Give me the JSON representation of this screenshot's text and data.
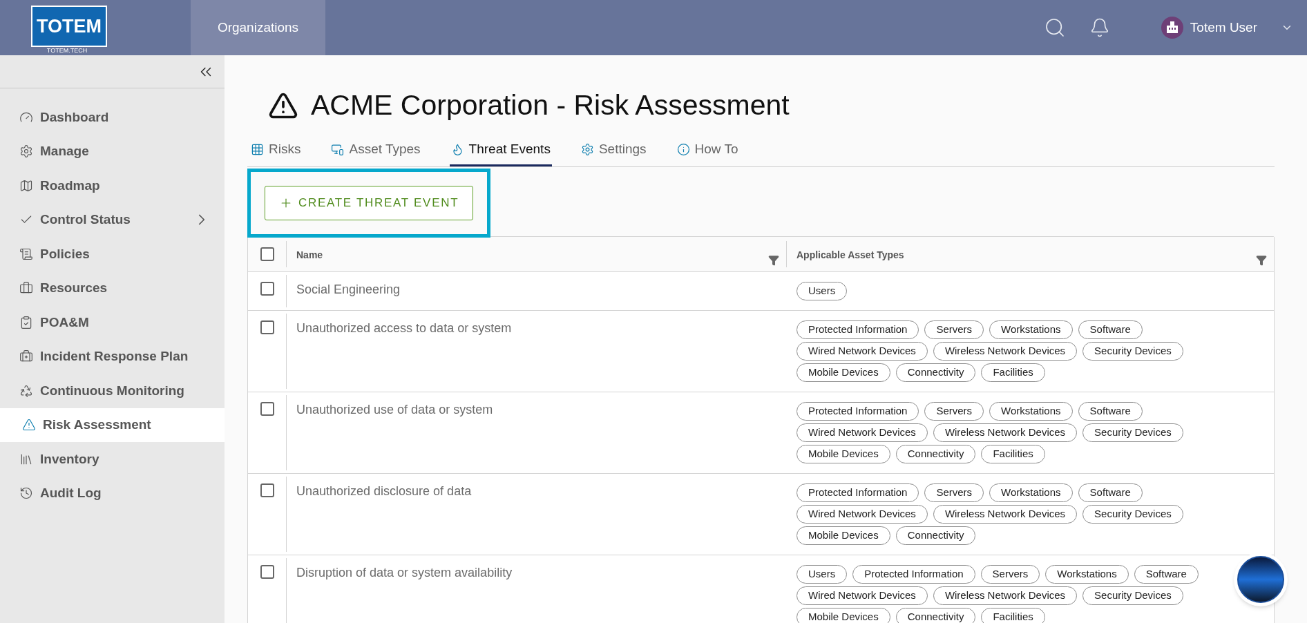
{
  "header": {
    "logo": {
      "text": "TOTEM",
      "subtext": "TOTEM.TECH"
    },
    "nav": [
      {
        "label": "Organizations",
        "selected": true
      }
    ],
    "user": {
      "name": "Totem User"
    }
  },
  "sidebar": {
    "items": [
      {
        "label": "Dashboard",
        "selected": false,
        "submenu": false
      },
      {
        "label": "Manage",
        "selected": false,
        "submenu": false
      },
      {
        "label": "Roadmap",
        "selected": false,
        "submenu": false
      },
      {
        "label": "Control Status",
        "selected": false,
        "submenu": true
      },
      {
        "label": "Policies",
        "selected": false,
        "submenu": false
      },
      {
        "label": "Resources",
        "selected": false,
        "submenu": false
      },
      {
        "label": "POA&M",
        "selected": false,
        "submenu": false
      },
      {
        "label": "Incident Response Plan",
        "selected": false,
        "submenu": false
      },
      {
        "label": "Continuous Monitoring",
        "selected": false,
        "submenu": false
      },
      {
        "label": "Risk Assessment",
        "selected": true,
        "submenu": false
      },
      {
        "label": "Inventory",
        "selected": false,
        "submenu": false
      },
      {
        "label": "Audit Log",
        "selected": false,
        "submenu": false
      }
    ]
  },
  "page": {
    "title": "ACME Corporation - Risk Assessment",
    "tabs": [
      {
        "label": "Risks",
        "selected": false
      },
      {
        "label": "Asset Types",
        "selected": false
      },
      {
        "label": "Threat Events",
        "selected": true
      },
      {
        "label": "Settings",
        "selected": false
      },
      {
        "label": "How To",
        "selected": false
      }
    ],
    "create_button": {
      "label": "CREATE THREAT EVENT",
      "highlighted": true
    },
    "table": {
      "select_all": {
        "checked": false
      },
      "columns": [
        "Name",
        "Applicable Asset Types"
      ],
      "rows": [
        {
          "checked": false,
          "name": "Social Engineering",
          "asset_types": [
            "Users"
          ]
        },
        {
          "checked": false,
          "name": "Unauthorized access to data or system",
          "asset_types": [
            "Protected Information",
            "Servers",
            "Workstations",
            "Software",
            "Wired Network Devices",
            "Wireless Network Devices",
            "Security Devices",
            "Mobile Devices",
            "Connectivity",
            "Facilities"
          ]
        },
        {
          "checked": false,
          "name": "Unauthorized use of data or system",
          "asset_types": [
            "Protected Information",
            "Servers",
            "Workstations",
            "Software",
            "Wired Network Devices",
            "Wireless Network Devices",
            "Security Devices",
            "Mobile Devices",
            "Connectivity",
            "Facilities"
          ]
        },
        {
          "checked": false,
          "name": "Unauthorized disclosure of data",
          "asset_types": [
            "Protected Information",
            "Servers",
            "Workstations",
            "Software",
            "Wired Network Devices",
            "Wireless Network Devices",
            "Security Devices",
            "Mobile Devices",
            "Connectivity"
          ]
        },
        {
          "checked": false,
          "name": "Disruption of data or system availability",
          "asset_types": [
            "Users",
            "Protected Information",
            "Servers",
            "Workstations",
            "Software",
            "Wired Network Devices",
            "Wireless Network Devices",
            "Security Devices",
            "Mobile Devices",
            "Connectivity",
            "Facilities"
          ]
        }
      ]
    }
  }
}
